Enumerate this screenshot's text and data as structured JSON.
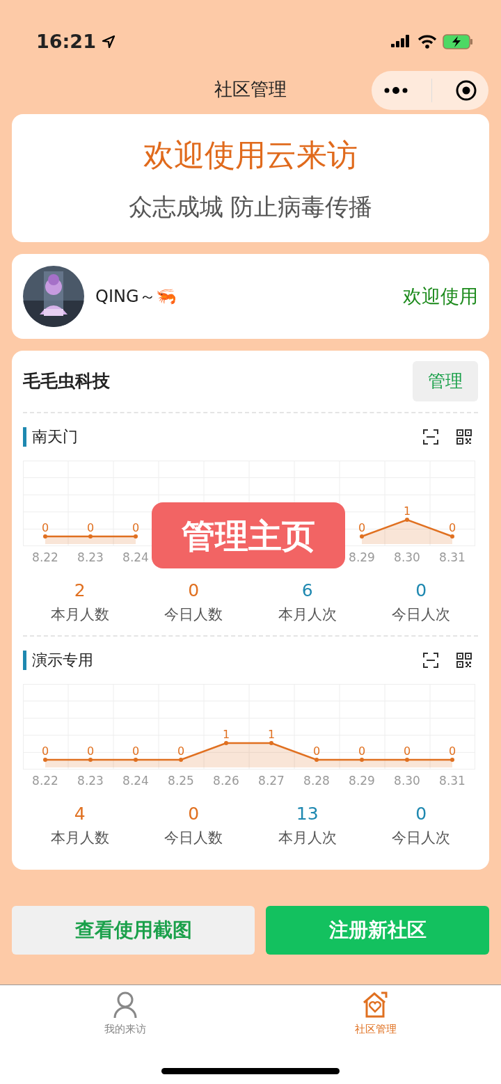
{
  "status_bar": {
    "time": "16:21"
  },
  "nav": {
    "title": "社区管理"
  },
  "banner": {
    "title": "欢迎使用云来访",
    "subtitle": "众志成城 防止病毒传播"
  },
  "user": {
    "name": "QING～🦐",
    "greeting": "欢迎使用"
  },
  "community": {
    "name": "毛毛虫科技",
    "manage_button": "管理",
    "sites": [
      {
        "name": "南天门",
        "chart_data": {
          "type": "line",
          "categories": [
            "8.22",
            "8.23",
            "8.24",
            null,
            null,
            null,
            null,
            "8.29",
            "8.30",
            "8.31"
          ],
          "series": [
            {
              "color": "#e07020",
              "marker": "circle",
              "values": [
                0,
                0,
                0,
                null,
                null,
                null,
                null,
                0,
                1,
                0
              ]
            }
          ],
          "data_labels": true
        },
        "stats": [
          {
            "value": "2",
            "label": "本月人数",
            "color": "#e07020"
          },
          {
            "value": "0",
            "label": "今日人数",
            "color": "#e07020"
          },
          {
            "value": "6",
            "label": "本月人次",
            "color": "#1e88b0"
          },
          {
            "value": "0",
            "label": "今日人次",
            "color": "#1e88b0"
          }
        ]
      },
      {
        "name": "演示专用",
        "chart_data": {
          "type": "line",
          "categories": [
            "8.22",
            "8.23",
            "8.24",
            "8.25",
            "8.26",
            "8.27",
            "8.28",
            "8.29",
            "8.30",
            "8.31"
          ],
          "series": [
            {
              "color": "#e07020",
              "marker": "circle",
              "values": [
                0,
                0,
                0,
                0,
                1,
                1,
                0,
                0,
                0,
                0
              ]
            }
          ],
          "data_labels": true
        },
        "stats": [
          {
            "value": "4",
            "label": "本月人数",
            "color": "#e07020"
          },
          {
            "value": "0",
            "label": "今日人数",
            "color": "#e07020"
          },
          {
            "value": "13",
            "label": "本月人次",
            "color": "#1e88b0"
          },
          {
            "value": "0",
            "label": "今日人次",
            "color": "#1e88b0"
          }
        ]
      }
    ]
  },
  "toast": "管理主页",
  "buttons": [
    {
      "label": "查看使用截图",
      "kind": "secondary"
    },
    {
      "label": "注册新社区",
      "kind": "primary"
    }
  ],
  "tab_bar": [
    {
      "label": "我的来访",
      "kind": "person",
      "selected": false
    },
    {
      "label": "社区管理",
      "kind": "house",
      "selected": true
    }
  ]
}
